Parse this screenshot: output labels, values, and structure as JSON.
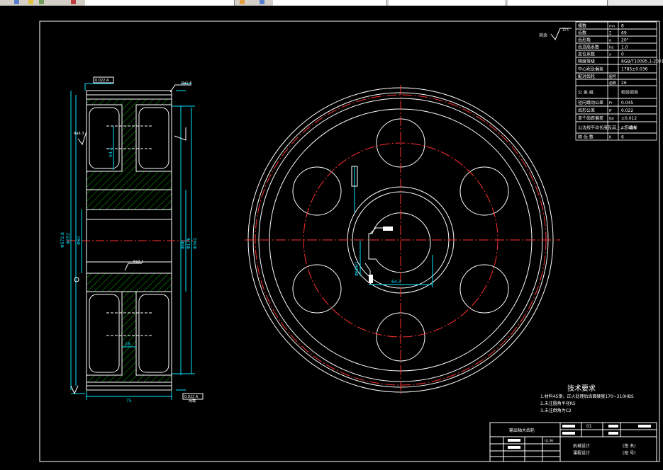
{
  "window": {
    "toolbar_icons": [
      "layer-icon",
      "check-icon",
      "sun-icon",
      "folder-icon",
      "layer-state-icon",
      "properties-icon"
    ]
  },
  "param_table": {
    "rows": [
      {
        "label": "模数",
        "sym": "mn",
        "val": "8"
      },
      {
        "label": "齿数",
        "sym": "Z",
        "val": "69"
      },
      {
        "label": "齿形角",
        "sym": "α",
        "val": "20°"
      },
      {
        "label": "齿顶高系数",
        "sym": "ha",
        "val": "1.0"
      },
      {
        "label": "变位系数",
        "sym": "x",
        "val": "0"
      },
      {
        "label": "精度等级",
        "sym": "",
        "val": "8GB/T10095.1-2001"
      },
      {
        "label": "中心距及偏差",
        "sym": "",
        "val": "1785±0.036"
      },
      {
        "label": "配对齿轮",
        "sym": "图号",
        "val": ""
      },
      {
        "label": "",
        "sym": "齿数",
        "val": "26"
      },
      {
        "label": "公 差 组",
        "sym": "",
        "val": "检验项目"
      },
      {
        "label": "径向跳动公差",
        "sym": "Fr",
        "val": "0.045"
      },
      {
        "label": "齿形公差",
        "sym": "ff",
        "val": "0.022"
      },
      {
        "label": "单个齿距偏差",
        "sym": "fpt",
        "val": "±0.012"
      },
      {
        "label": "公法线平均长度及其上、下偏差",
        "sym": "",
        "val": "42.459"
      },
      {
        "label": "跨 齿 数",
        "sym": "K",
        "val": "6"
      }
    ]
  },
  "notes": {
    "title": "技术要求",
    "items": [
      "1.材料45钢，正火处理后齿面硬度170~210HBS",
      "2.未注圆角半径R5",
      "3.未注倒角为C2"
    ]
  },
  "title_block": {
    "name": "输出轴大齿轮",
    "scale": "(比 例)",
    "qty": "01",
    "course1": "机械设计",
    "course2": "课程设计",
    "sign1": "(签 名)",
    "sign2": "(班 号)",
    "left_rows": [
      "",
      "",
      "",
      ""
    ]
  },
  "dims": {
    "d_tip": "Φ572.8",
    "d_pitch": "Φ552",
    "d_bore": "Φ60",
    "d_hub": "Φ96",
    "d_rim": "Φ176",
    "d_rim2": "Φ342",
    "width": "75",
    "web": "18",
    "keyway": "64.3",
    "bore_tol": "Φ60H7",
    "rough_note": "其余",
    "rough_val": "12.5",
    "gtol1": "0.022 A",
    "gtol2": "0.022 A",
    "datum": "A",
    "ra1": "Ra1.6",
    "ra2": "Ra3.2",
    "ra3": "Ra6.3",
    "hub_chamfer": "2×45",
    "face": "两端"
  }
}
